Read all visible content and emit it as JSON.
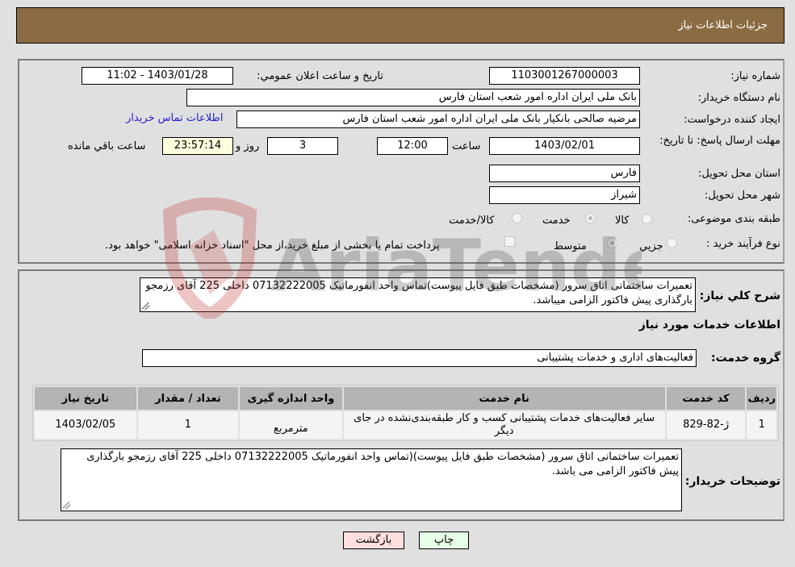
{
  "header": {
    "title": "جزئيات اطلاعات نياز"
  },
  "form": {
    "need_number": {
      "label": "شماره نياز:",
      "value": "1103001267000003"
    },
    "announce_datetime": {
      "label": "تاريخ و ساعت اعلان عمومي:",
      "value": "1403/01/28 - 11:02"
    },
    "buyer_org": {
      "label": "نام دستگاه خريدار:",
      "value": "بانک ملی ایران اداره امور شعب استان فارس"
    },
    "requester": {
      "label": "ايجاد کننده درخواست:",
      "value": "مرضیه صالحی بانکیار بانک ملی ایران اداره امور شعب استان فارس"
    },
    "buyer_contact_link": "اطلاعات تماس خريدار",
    "deadline": {
      "label": "مهلت ارسال پاسخ: تا تاريخ:",
      "date": "1403/02/01",
      "time_label": "ساعت",
      "time": "12:00",
      "days": "3",
      "days_label": "روز و",
      "remaining": "23:57:14",
      "remaining_label": "ساعت باقي مانده"
    },
    "delivery_province": {
      "label": "استان محل تحويل:",
      "value": "فارس"
    },
    "delivery_city": {
      "label": "شهر محل تحويل:",
      "value": "شیراز"
    },
    "category": {
      "label": "طبقه بندی موضوعی:",
      "options": [
        "کالا",
        "خدمت",
        "کالا/خدمت"
      ],
      "selected": "خدمت"
    },
    "purchase_type": {
      "label": "نوع فرآيند خريد :",
      "options": [
        "جزيي",
        "متوسط"
      ],
      "selected": "متوسط",
      "treasury_checkbox_label": "پرداخت تمام یا بخشی از مبلغ خرید،از محل \"اسناد خزانه اسلامی\" خواهد بود.",
      "treasury_checked": false
    }
  },
  "details": {
    "general_desc_label": "شرح کلي نياز:",
    "general_desc": "تعمیرات ساختمانی اتاق سرور (مشخصات طبق فایل پیوست)تماس واحد انفورماتیک 07132222005 داخلی 225 آقای رزمجو بارگذاری پیش فاکتور الزامی میباشد.",
    "services_heading": "اطلاعات خدمات مورد نياز",
    "service_group_label": "گروه خدمت:",
    "service_group": "فعالیت‌های اداری و خدمات پشتیبانی",
    "table": {
      "columns": [
        "رديف",
        "کد خدمت",
        "نام خدمت",
        "واحد اندازه گيری",
        "تعداد / مقدار",
        "تاريخ نياز"
      ],
      "rows": [
        [
          "1",
          "ژ-82-829",
          "سایر فعالیت‌های خدمات پشتیبانی کسب و کار طبقه‌بندی‌نشده در جای دیگر",
          "مترمربع",
          "1",
          "1403/02/05"
        ]
      ]
    },
    "buyer_notes_label": "توضيحات خريدار:",
    "buyer_notes": "تعمیرات ساختمانی اتاق سرور (مشخصات طبق فایل پیوست)(تماس واحد انفورماتیک 07132222005 داخلی 225 آقای رزمجو بارگذاری پیش فاکتور الزامی می باشد."
  },
  "buttons": {
    "print": "چاپ",
    "back": "بازگشت"
  },
  "watermark": {
    "text": "AriaTender.neT"
  },
  "colors": {
    "header_bg": "#8b6c42",
    "remaining_bg": "#ffffe0",
    "back_btn": "#ffdede",
    "print_btn": "#e6ffe6",
    "link": "#2222cc"
  }
}
